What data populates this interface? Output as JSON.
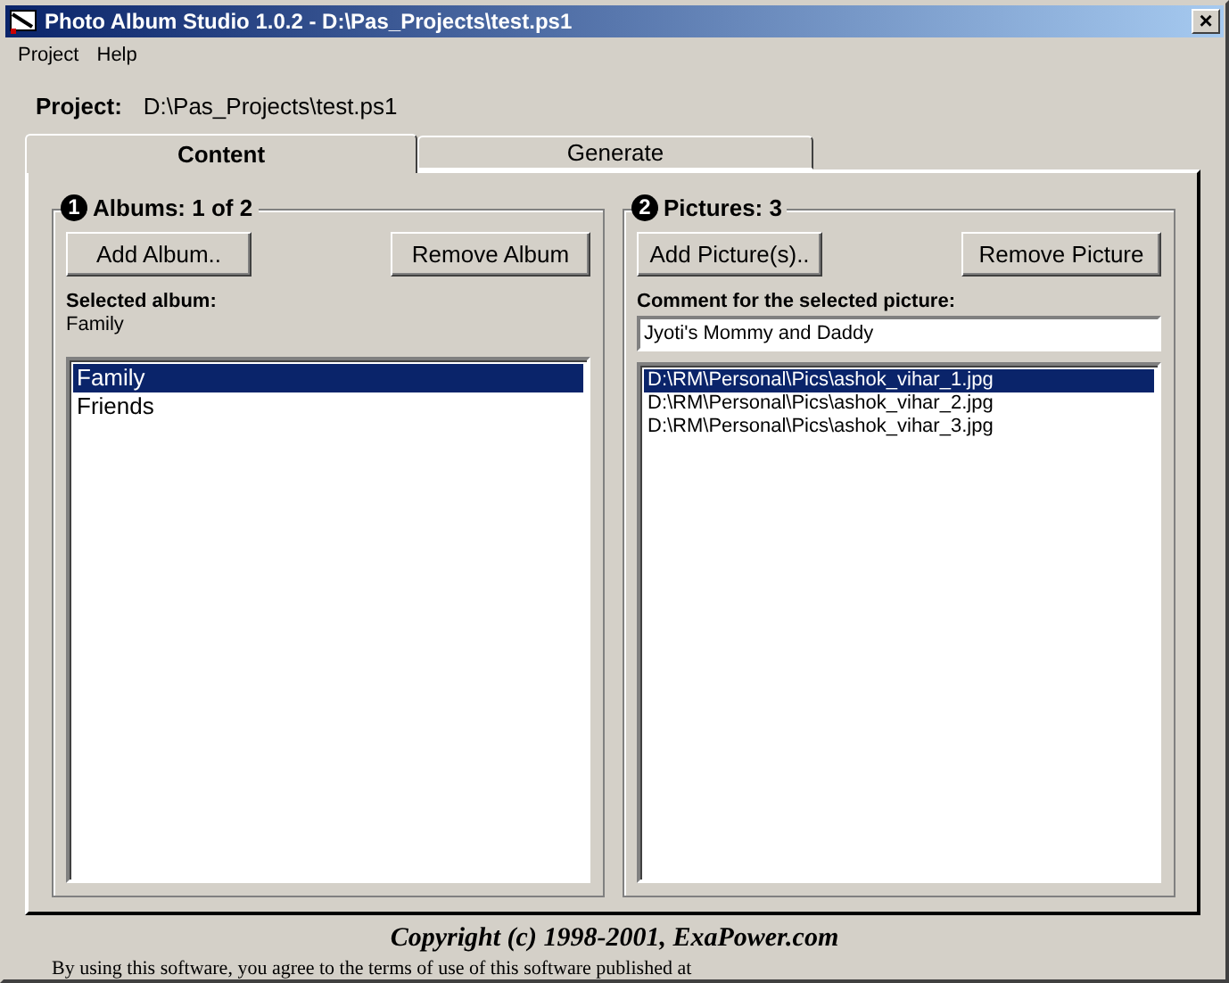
{
  "window": {
    "title": "Photo Album Studio 1.0.2 - D:\\Pas_Projects\\test.ps1",
    "close": "×"
  },
  "menu": [
    "Project",
    "Help"
  ],
  "project": {
    "label": "Project:",
    "path": "D:\\Pas_Projects\\test.ps1"
  },
  "tabs": [
    {
      "label": "Content",
      "selected": true
    },
    {
      "label": "Generate",
      "selected": false
    }
  ],
  "albums": {
    "badge": "1",
    "title": "Albums: 1 of 2",
    "buttons": [
      "Add Album..",
      "Remove Album"
    ],
    "selected_label": "Selected album:",
    "selected_value": "Family",
    "items": [
      {
        "label": "Family",
        "selected": true
      },
      {
        "label": "Friends",
        "selected": false
      }
    ]
  },
  "pictures": {
    "badge": "2",
    "title": "Pictures: 3",
    "buttons": [
      "Add Picture(s)..",
      "Remove Picture"
    ],
    "comment_label": "Comment for the selected picture:",
    "comment_value": "Jyoti's Mommy and Daddy",
    "items": [
      {
        "label": "D:\\RM\\Personal\\Pics\\ashok_vihar_1.jpg",
        "selected": true
      },
      {
        "label": "D:\\RM\\Personal\\Pics\\ashok_vihar_2.jpg",
        "selected": false
      },
      {
        "label": "D:\\RM\\Personal\\Pics\\ashok_vihar_3.jpg",
        "selected": false
      }
    ]
  },
  "footer": {
    "copyright": "Copyright (c) 1998-2001, ExaPower.com",
    "terms": "By using this software, you agree to the terms of use of this software published at"
  }
}
